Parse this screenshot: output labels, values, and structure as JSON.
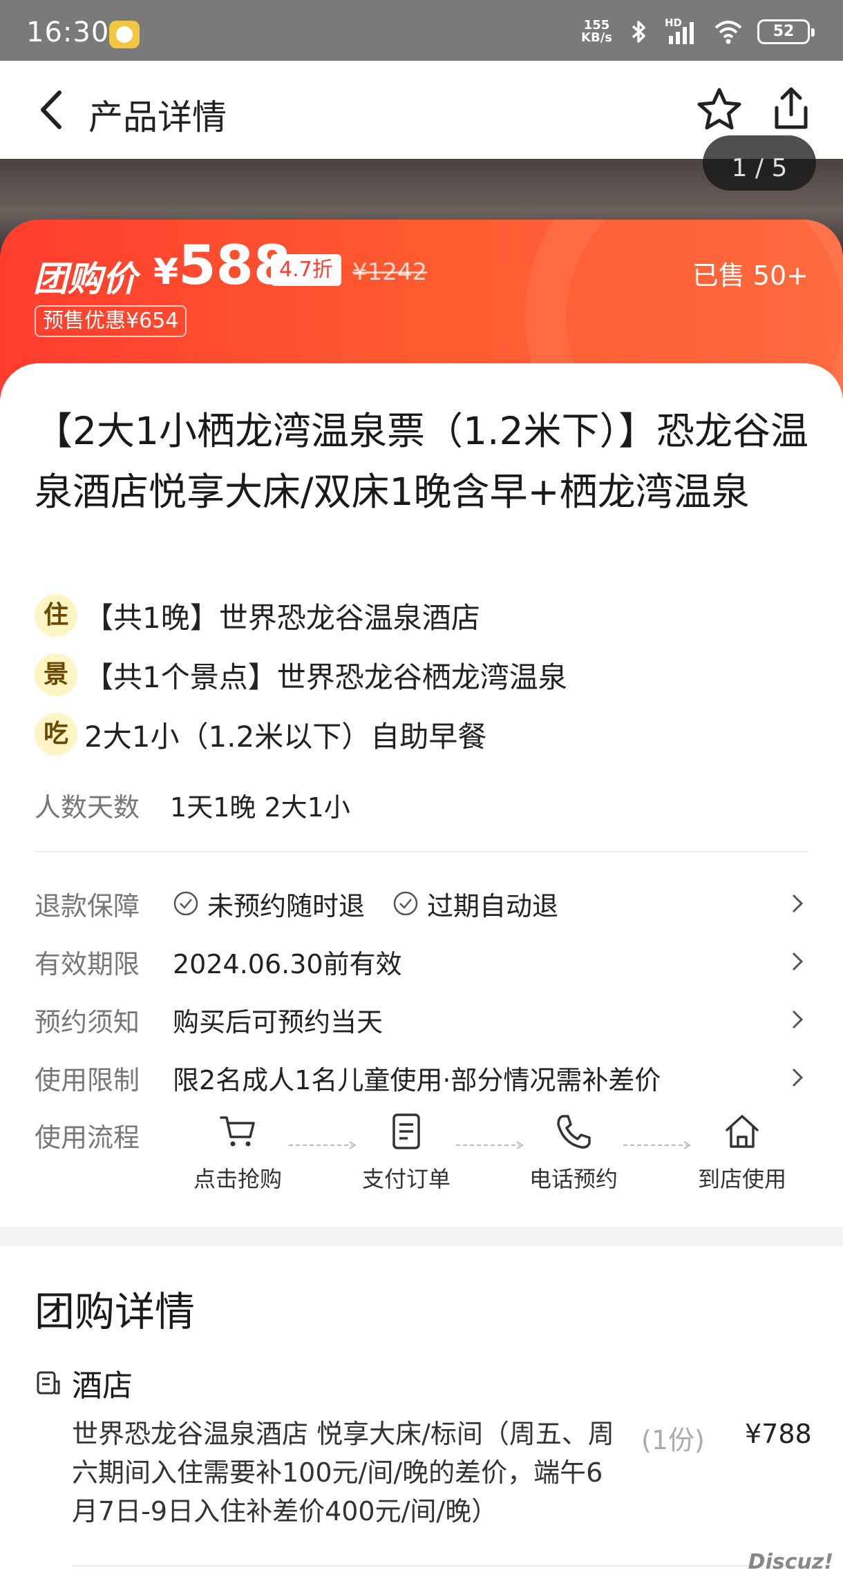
{
  "status_bar": {
    "time": "16:30",
    "net_speed_value": "155",
    "net_speed_unit": "KB/s",
    "signal_label": "HD",
    "battery": "52"
  },
  "nav": {
    "title": "产品详情"
  },
  "gallery": {
    "pager": "1 / 5"
  },
  "price": {
    "label": "团购价",
    "currency": "¥",
    "value": "588",
    "discount": "4.7折",
    "original": "¥1242",
    "sold": "已售 50+",
    "presale": "预售优惠¥654"
  },
  "product": {
    "title": "【2大1小栖龙湾温泉票（1.2米下）】恐龙谷温泉酒店悦享大床/双床1晚含早+栖龙湾温泉",
    "features": [
      {
        "badge": "住",
        "text": "【共1晚】世界恐龙谷温泉酒店"
      },
      {
        "badge": "景",
        "text": "【共1个景点】世界恐龙谷栖龙湾温泉"
      },
      {
        "badge": "吃",
        "text": "2大1小（1.2米以下）自助早餐"
      }
    ],
    "people_label": "人数天数",
    "people_value": "1天1晚 2大1小"
  },
  "info_rows": {
    "refund": {
      "label": "退款保障",
      "tag1": "未预约随时退",
      "tag2": "过期自动退"
    },
    "validity": {
      "label": "有效期限",
      "value": "2024.06.30前有效"
    },
    "booking": {
      "label": "预约须知",
      "value": "购买后可预约当天"
    },
    "limit": {
      "label": "使用限制",
      "value": "限2名成人1名儿童使用·部分情况需补差价"
    }
  },
  "flow": {
    "label": "使用流程",
    "steps": [
      "点击抢购",
      "支付订单",
      "电话预约",
      "到店使用"
    ],
    "icons": [
      "cart-icon",
      "document-icon",
      "phone-icon",
      "house-icon"
    ]
  },
  "detail": {
    "title": "团购详情",
    "section": "酒店",
    "item_desc": "世界恐龙谷温泉酒店 悦享大床/标间（周五、周六期间入住需要补100元/间/晚的差价，端午6月7日-9日入住补差价400元/间/晚）",
    "item_qty": "(1份)",
    "item_price": "¥788"
  },
  "watermark": "Discuz!",
  "colors": {
    "accent": "#ff3d2e",
    "accent_light": "#ff6a3e",
    "badge_bg": "#fff4c4"
  }
}
